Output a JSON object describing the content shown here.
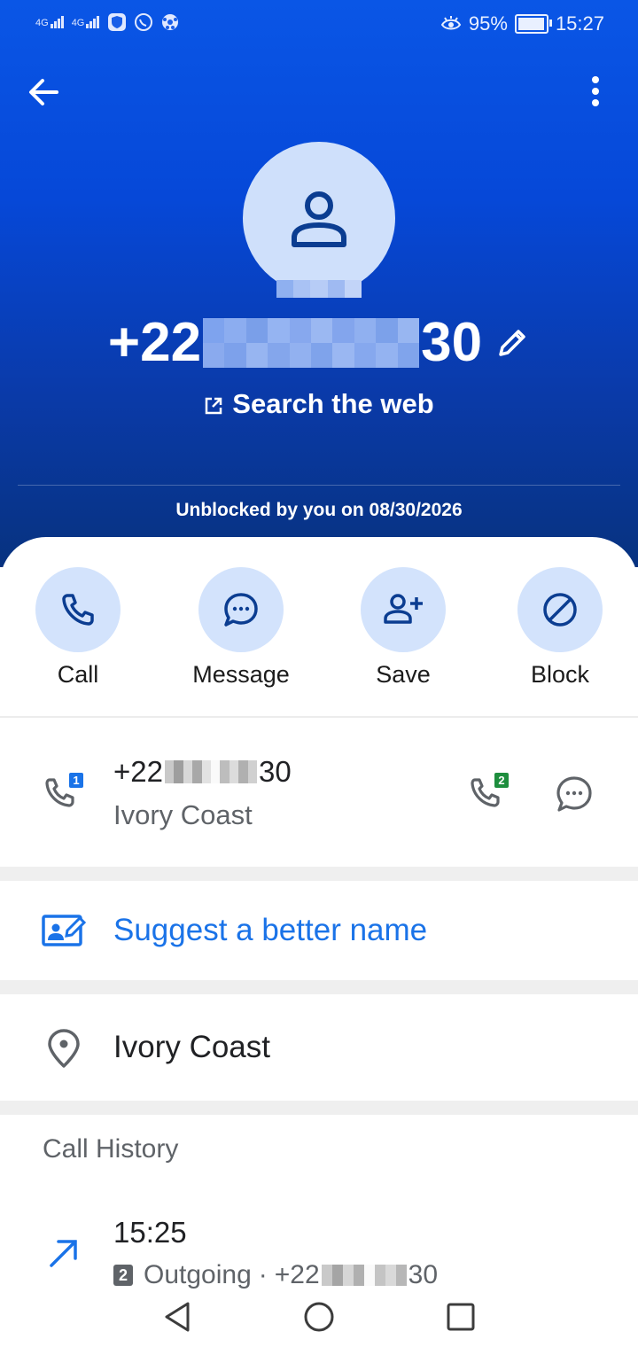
{
  "status_bar": {
    "signal1": "4G",
    "signal2": "4G",
    "battery_percent": "95%",
    "time": "15:27",
    "battery_level": 0.95
  },
  "contact": {
    "number_prefix": "+22",
    "number_suffix": "30",
    "search_web": "Search the web",
    "unblocked_text": "Unblocked by you on 08/30/2026"
  },
  "actions": [
    {
      "label": "Call",
      "icon": "phone-icon"
    },
    {
      "label": "Message",
      "icon": "message-bubble-icon"
    },
    {
      "label": "Save",
      "icon": "add-person-icon"
    },
    {
      "label": "Block",
      "icon": "block-icon"
    }
  ],
  "phone_entry": {
    "number_prefix": "+22",
    "number_suffix": "30",
    "country": "Ivory Coast",
    "sim1_badge": "1",
    "sim2_badge": "2"
  },
  "suggest": {
    "label": "Suggest a better name"
  },
  "location": {
    "label": "Ivory Coast"
  },
  "call_history": {
    "title": "Call History",
    "items": [
      {
        "time": "15:25",
        "sim": "2",
        "type": "Outgoing",
        "separator": "·",
        "number_prefix": "+22",
        "number_suffix": "30"
      }
    ]
  },
  "colors": {
    "header_top": "#0a56e6",
    "header_bottom": "#07327f",
    "accent_blue": "#1a73e8",
    "action_circle": "#d3e3fc",
    "icon_dark_blue": "#0b3d91",
    "sim1": "#1a73e8",
    "sim2": "#1e8e3e"
  }
}
